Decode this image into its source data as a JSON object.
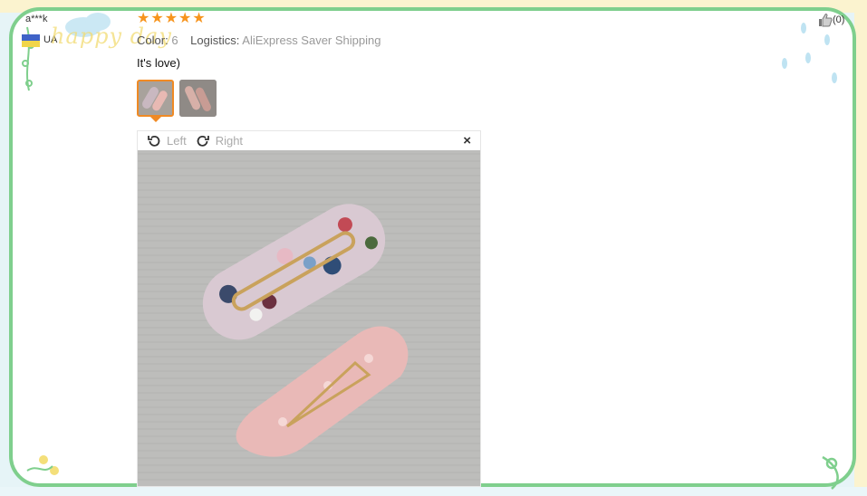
{
  "reviewer": {
    "name": "a***k",
    "country_code": "UA"
  },
  "watermark": "happy day",
  "rating": {
    "stars": 5,
    "max": 5
  },
  "meta": {
    "color_label": "Color:",
    "color_value": "6",
    "logistics_label": "Logistics:",
    "logistics_value": "AliExpress Saver Shipping"
  },
  "review_text": "It's love)",
  "thumbnails": [
    {
      "name": "thumbnail-1",
      "selected": true
    },
    {
      "name": "thumbnail-2",
      "selected": false
    }
  ],
  "viewer": {
    "rotate_left": "Left",
    "rotate_right": "Right",
    "close": "×"
  },
  "helpful": {
    "count": "(0)"
  },
  "colors": {
    "star": "#f7941d",
    "accent": "#f08a24",
    "frame": "#7fcf8d",
    "meta_value": "#999999"
  },
  "icons": [
    "rotate-left-icon",
    "rotate-right-icon",
    "close-icon",
    "thumbs-up-icon",
    "star-icon"
  ]
}
